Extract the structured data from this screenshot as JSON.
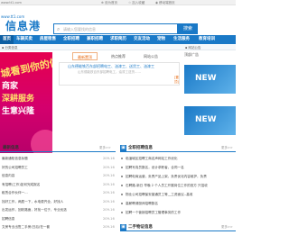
{
  "topbar": {
    "domain": "www.tt1.com",
    "links": [
      "⊕ 设为首页",
      "☆ 加入收藏",
      "◉ 移动端首页"
    ]
  },
  "header": {
    "logo_sub": "www.tt1.com",
    "logo_main": "信息港"
  },
  "search": {
    "placeholder": "请输入您要找的信息",
    "button_label": "搜索",
    "hot_words": "热门搜索：招聘  求职  房产  二手  商务"
  },
  "nav": {
    "items": [
      "首页",
      "车辆买卖",
      "房屋租售",
      "全职招聘",
      "兼职招聘",
      "求职简历",
      "交友活动",
      "宠物",
      "生活服务",
      "教育培训"
    ]
  },
  "subbar": {
    "left": "▪ 分类信息",
    "right": "▪ 网站公告"
  },
  "banner": {
    "lines": [
      "城看到你的信息",
      "商家",
      "深耕服务",
      "生意兴隆"
    ]
  },
  "tabs": {
    "items": [
      "最新置顶",
      "热点推荐",
      "网站公告"
    ]
  },
  "notice": {
    "title": "山东德能铁百东部招聘电工、油漆工、送货工、油漆工",
    "subtitle": "山东德能铁百东部招聘电工，油漆工送货……",
    "tag": "[置顶]"
  },
  "right_ad": {
    "header": "顶部广告",
    "ad1": "NEW",
    "ad2": "NEW"
  },
  "latest": {
    "title": "最新信息",
    "more": "更多>>",
    "rows": [
      {
        "text": "最新通知信息标题",
        "date": "209-16"
      },
      {
        "text": "好的公司招聘员工",
        "date": "209-16"
      },
      {
        "text": "信息内容",
        "date": "209-16"
      },
      {
        "text": "有招聘(工作)如何完成报名",
        "date": "209-16"
      },
      {
        "text": "租赁合作伙伴一…",
        "date": "209-16"
      },
      {
        "text": "找好工作，两居一下，水电费齐全，好找人",
        "date": "209-16"
      },
      {
        "text": "出发运作，回收路面，好找一位于，专业优选",
        "date": "209-16"
      },
      {
        "text": "招聘信息",
        "date": "209-16"
      },
      {
        "text": "文房专业出售二手房(日后)在一套",
        "date": "209-16"
      }
    ]
  },
  "jobs": {
    "title": "全职招聘信息",
    "more": "更多>>",
    "rows": [
      "临淄城区招聘工商名声网站工作优化",
      "招聘写真员数名，设计求职者，合同一名",
      "招聘电商运营，负责产品上架，负责优化内容维护，负责",
      "石聘路-新日 早晚 2 个人员工开展岗位工作的官方 只招收",
      "物业公司招聘保安普通员工等__工资面议--高收",
      "高薪聘请厨师招聘数名",
      "招聘一个营销招聘员工管理事务的工作"
    ]
  },
  "used": {
    "title": "二手物证信息",
    "more": "更多>>"
  }
}
